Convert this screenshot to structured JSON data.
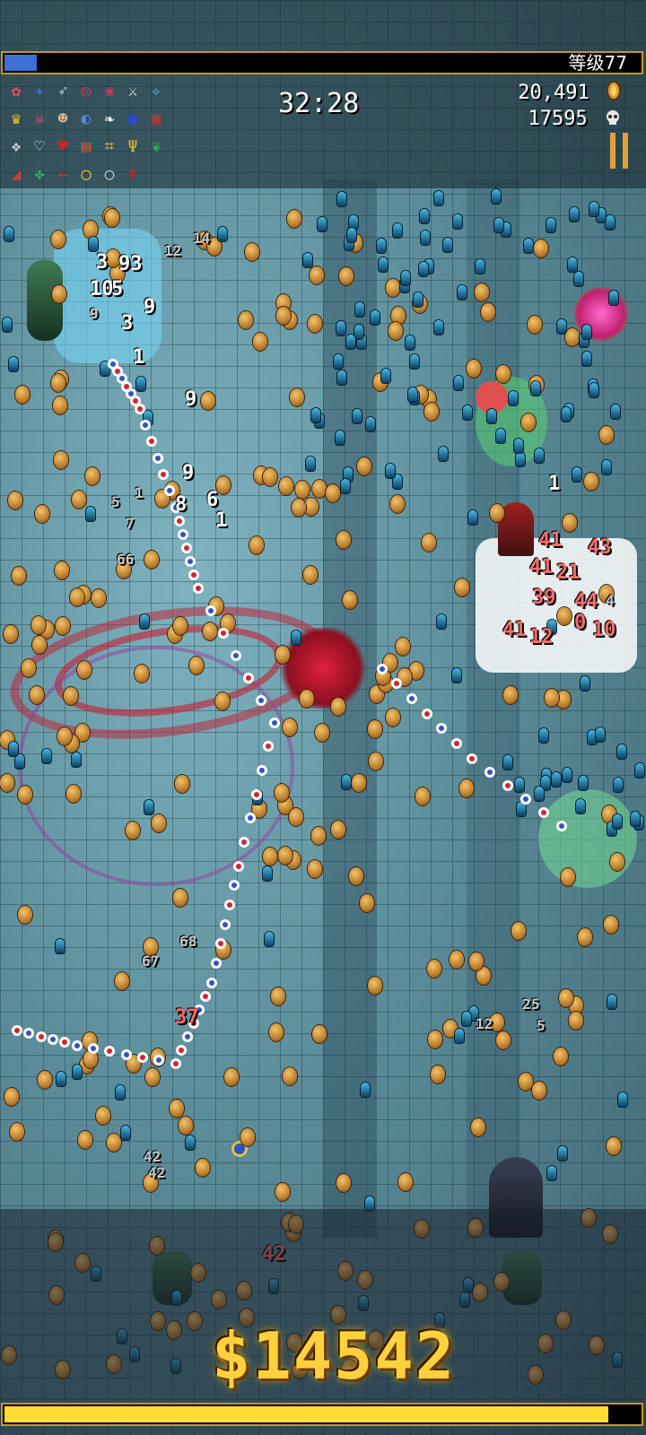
{
  "hud": {
    "level_label": "等级77",
    "experience_fraction": 0.05,
    "timer": "32:28",
    "gold": "20,491",
    "kills": "17595",
    "gold_icon": "coin-icon",
    "kill_icon": "skull-icon",
    "pause_icon": "pause-icon"
  },
  "inventory": [
    {
      "name": "flower-weapon-icon",
      "glyph": "✿",
      "color": "#e84a5f"
    },
    {
      "name": "phieraggi-icon",
      "glyph": "✦",
      "color": "#4a6ad8"
    },
    {
      "name": "spear-icon",
      "glyph": "➶",
      "color": "#b9c4d0"
    },
    {
      "name": "target-icon",
      "glyph": "◎",
      "color": "#c23c5c"
    },
    {
      "name": "rose-icon",
      "glyph": "❀",
      "color": "#d83a5a"
    },
    {
      "name": "sword-icon",
      "glyph": "⚔",
      "color": "#d8d8d8"
    },
    {
      "name": "wand-icon",
      "glyph": "✧",
      "color": "#5ac8e8"
    },
    {
      "name": "crown-icon",
      "glyph": "♛",
      "color": "#f0c030"
    },
    {
      "name": "skull-mask-icon",
      "glyph": "☠",
      "color": "#e05080"
    },
    {
      "name": "face-icon",
      "glyph": "☻",
      "color": "#e0b890"
    },
    {
      "name": "ring-icon",
      "glyph": "◐",
      "color": "#4a8ae0"
    },
    {
      "name": "wing-icon",
      "glyph": "❧",
      "color": "#ffffff"
    },
    {
      "name": "orb-icon",
      "glyph": "●",
      "color": "#2a4ad0"
    },
    {
      "name": "tome-icon",
      "glyph": "▣",
      "color": "#c83030"
    },
    {
      "name": "magnet-icon",
      "glyph": "❖",
      "color": "#c0c8d0"
    },
    {
      "name": "heart-outline-icon",
      "glyph": "♡",
      "color": "#e0e0e0"
    },
    {
      "name": "heart-icon",
      "glyph": "♥",
      "color": "#d82020"
    },
    {
      "name": "cake-icon",
      "glyph": "▤",
      "color": "#c06040"
    },
    {
      "name": "cage-icon",
      "glyph": "⌗",
      "color": "#e0b030"
    },
    {
      "name": "trident-icon",
      "glyph": "Ψ",
      "color": "#e0b030"
    },
    {
      "name": "leaf-icon",
      "glyph": "❦",
      "color": "#2ab04a"
    },
    {
      "name": "ham-icon",
      "glyph": "◢",
      "color": "#c04040"
    },
    {
      "name": "clover-icon",
      "glyph": "✤",
      "color": "#2ab04a"
    },
    {
      "name": "arrow-left-icon",
      "glyph": "←",
      "color": "#e02a2a"
    },
    {
      "name": "gold-ring-icon",
      "glyph": "◯",
      "color": "#f0c020"
    },
    {
      "name": "silver-ring-icon",
      "glyph": "○",
      "color": "#c8d0d8"
    },
    {
      "name": "candle-icon",
      "glyph": "♆",
      "color": "#d82020"
    }
  ],
  "damage_numbers": [
    "3",
    "93",
    "10",
    "5",
    "9",
    "3",
    "9",
    "1",
    "12",
    "14",
    "9",
    "9",
    "8",
    "6",
    "1",
    "1",
    "66",
    "7",
    "5",
    "41",
    "43",
    "41",
    "21",
    "39",
    "44",
    "41",
    "12",
    "10",
    "4",
    "0",
    "68",
    "67",
    "37",
    "42",
    "42",
    "12",
    "5",
    "2",
    "5",
    "42",
    "1"
  ],
  "money": "$14542",
  "bottom_bar_fraction": 0.95
}
